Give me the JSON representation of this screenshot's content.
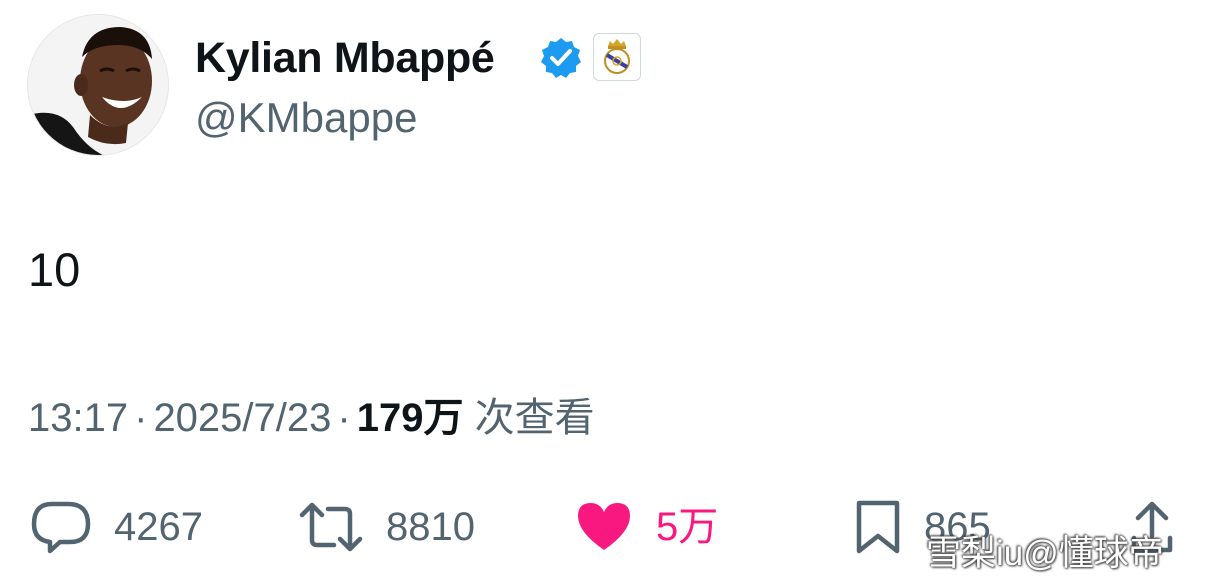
{
  "author": {
    "display_name": "Kylian Mbappé",
    "handle": "@KMbappe",
    "verified": true,
    "badge_icon": "real-madrid-crest-icon"
  },
  "tweet": {
    "text": "10",
    "time": "13:17",
    "date": "2025/7/23",
    "separator": "·",
    "views_count": "179万",
    "views_label": "次查看"
  },
  "actions": {
    "replies": "4267",
    "retweets": "8810",
    "likes": "5万",
    "bookmarks": "865"
  },
  "watermark": "雪梨iu@懂球帝",
  "colors": {
    "text": "#0f1419",
    "secondary": "#536471",
    "verified_blue": "#1d9bf0",
    "like_pink": "#f91880"
  }
}
